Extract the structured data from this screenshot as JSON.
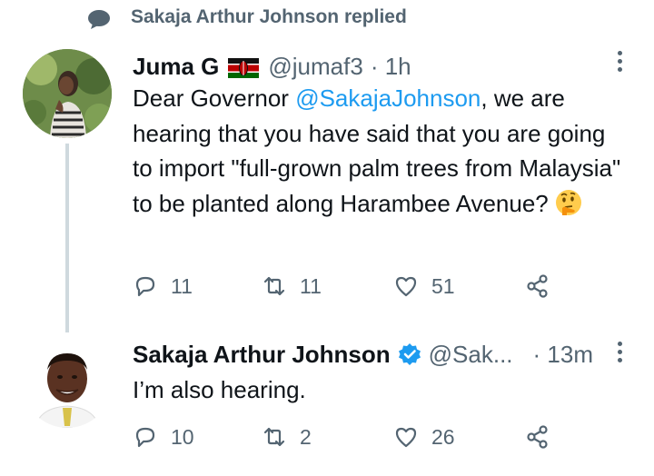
{
  "context": {
    "text": "Sakaja Arthur Johnson replied"
  },
  "tweets": [
    {
      "name": "Juma G",
      "handle": "@jumaf3",
      "time": "· 1h",
      "text_pre": "Dear Governor ",
      "mention": "@SakajaJohnson",
      "text_post": ", we are hearing that you have said that you are going to import \"full-grown palm trees from Malaysia\" to be planted along Harambee Avenue?",
      "actions": {
        "replies": "11",
        "retweets": "11",
        "likes": "51"
      }
    },
    {
      "name": "Sakaja Arthur Johnson",
      "handle": "@Sak...",
      "time": "· 13m",
      "text": "I’m also hearing.",
      "actions": {
        "replies": "10",
        "retweets": "2",
        "likes": "26"
      }
    }
  ],
  "icons": [
    "speech-bubble-icon",
    "kenya-flag-icon",
    "verified-badge-icon",
    "more-icon",
    "reply-icon",
    "retweet-icon",
    "like-icon",
    "share-icon",
    "thinking-face-emoji"
  ],
  "colors": {
    "accent": "#1d9bf0",
    "muted": "#536471",
    "text": "#0f1419",
    "thread_line": "#cfd9de"
  }
}
